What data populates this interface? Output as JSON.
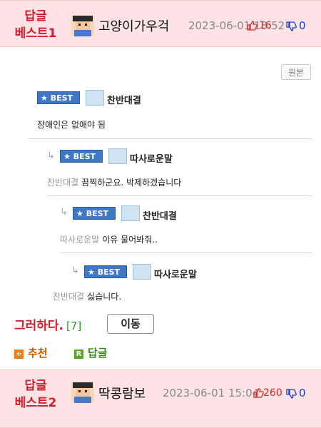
{
  "post1": {
    "rank_line1": "답글",
    "rank_line2": "베스트1",
    "nickname": "고양이가우걱",
    "date": "2023-06-01 18:52",
    "up": "16",
    "down": "0"
  },
  "original_button": "원본",
  "comments": [
    {
      "badge": "★ BEST",
      "nick": "찬반대결",
      "reply_to": "",
      "text": "장애인은 없애야 됨"
    },
    {
      "badge": "★ BEST",
      "nick": "따사로운말",
      "reply_to": "찬반대결",
      "text": "끔찍하군요. 박제하겠습니다"
    },
    {
      "badge": "★ BEST",
      "nick": "찬반대결",
      "reply_to": "따사로운말",
      "text": "이유 물어봐줘.."
    },
    {
      "badge": "★ BEST",
      "nick": "따사로운말",
      "reply_to": "찬반대결",
      "text": "싫습니다."
    }
  ],
  "title": "그러하다.",
  "title_count": "[7]",
  "move_button": "이동",
  "recommend_label": "추천",
  "reply_label": "답글",
  "post2": {
    "rank_line1": "답글",
    "rank_line2": "베스트2",
    "nickname": "딱콩람보",
    "date": "2023-06-01 15:04",
    "up": "260",
    "down": "0"
  },
  "colors": {
    "header_bg": "#fde3e5",
    "rank_red": "#d11e2a",
    "best_blue": "#3f78c7",
    "down_blue": "#1b3bb8",
    "count_green": "#2c9a2c"
  }
}
